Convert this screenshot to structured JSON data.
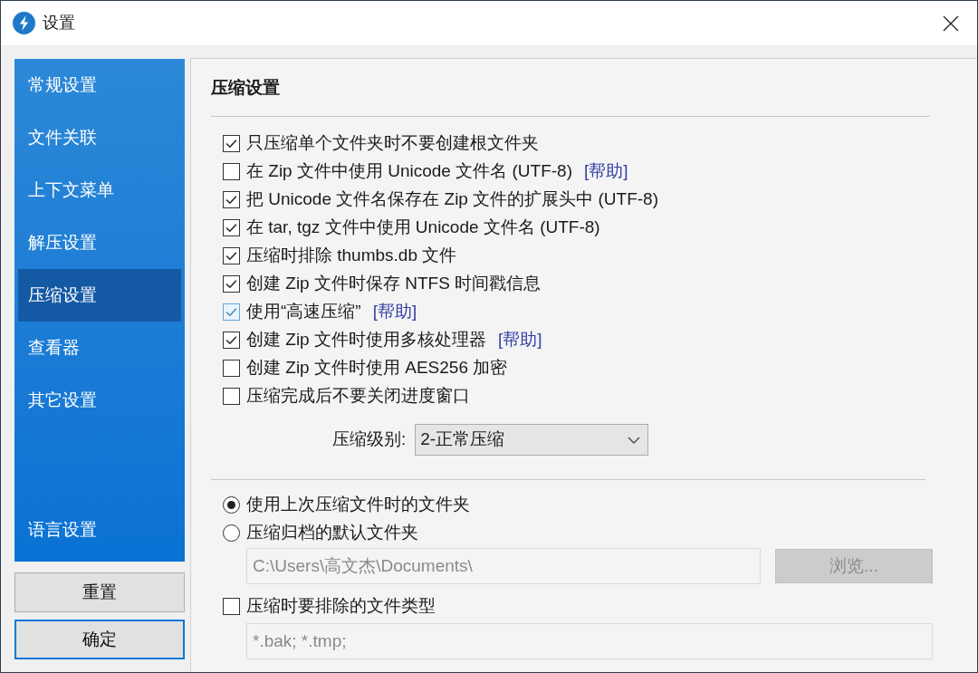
{
  "window": {
    "title": "设置"
  },
  "sidebar": {
    "items": [
      {
        "label": "常规设置",
        "selected": false
      },
      {
        "label": "文件关联",
        "selected": false
      },
      {
        "label": "上下文菜单",
        "selected": false
      },
      {
        "label": "解压设置",
        "selected": false
      },
      {
        "label": "压缩设置",
        "selected": true
      },
      {
        "label": "查看器",
        "selected": false
      },
      {
        "label": "其它设置",
        "selected": false
      }
    ],
    "footer_items": [
      {
        "label": "语言设置",
        "selected": false
      }
    ]
  },
  "buttons": [
    {
      "label": "重置",
      "default": false
    },
    {
      "label": "确定",
      "default": true
    }
  ],
  "section": {
    "title": "压缩设置"
  },
  "options": [
    {
      "label": "只压缩单个文件夹时不要创建根文件夹",
      "checked": true,
      "hovered": false
    },
    {
      "label": "在 Zip 文件中使用 Unicode 文件名 (UTF-8)",
      "checked": false,
      "hovered": false,
      "help_link": "[帮助]"
    },
    {
      "label": "把 Unicode 文件名保存在 Zip 文件的扩展头中 (UTF-8)",
      "checked": true,
      "hovered": false
    },
    {
      "label": "在 tar, tgz 文件中使用 Unicode 文件名 (UTF-8)",
      "checked": true,
      "hovered": false
    },
    {
      "label": "压缩时排除 thumbs.db 文件",
      "checked": true,
      "hovered": false
    },
    {
      "label": "创建 Zip 文件时保存 NTFS 时间戳信息",
      "checked": true,
      "hovered": false
    },
    {
      "label": "使用“高速压缩”",
      "checked": true,
      "hovered": true,
      "help_link": "[帮助]"
    },
    {
      "label": "创建 Zip 文件时使用多核处理器",
      "checked": true,
      "hovered": false,
      "help_link": "[帮助]"
    },
    {
      "label": "创建 Zip 文件时使用 AES256 加密",
      "checked": false,
      "hovered": false
    },
    {
      "label": "压缩完成后不要关闭进度窗口",
      "checked": false,
      "hovered": false
    }
  ],
  "compression_level": {
    "label": "压缩级别:",
    "value": "2-正常压缩"
  },
  "destination": {
    "options": [
      {
        "label": "使用上次压缩文件时的文件夹",
        "selected": true
      },
      {
        "label": "压缩归档的默认文件夹",
        "selected": false
      }
    ],
    "path_field": {
      "value": "C:\\Users\\高文杰\\Documents\\",
      "disabled": true
    },
    "browse_button": {
      "label": "浏览...",
      "disabled": true
    }
  },
  "exclude": {
    "label": "压缩时要排除的文件类型",
    "checked": false,
    "field": {
      "value": "*.bak; *.tmp;",
      "disabled": true
    }
  }
}
